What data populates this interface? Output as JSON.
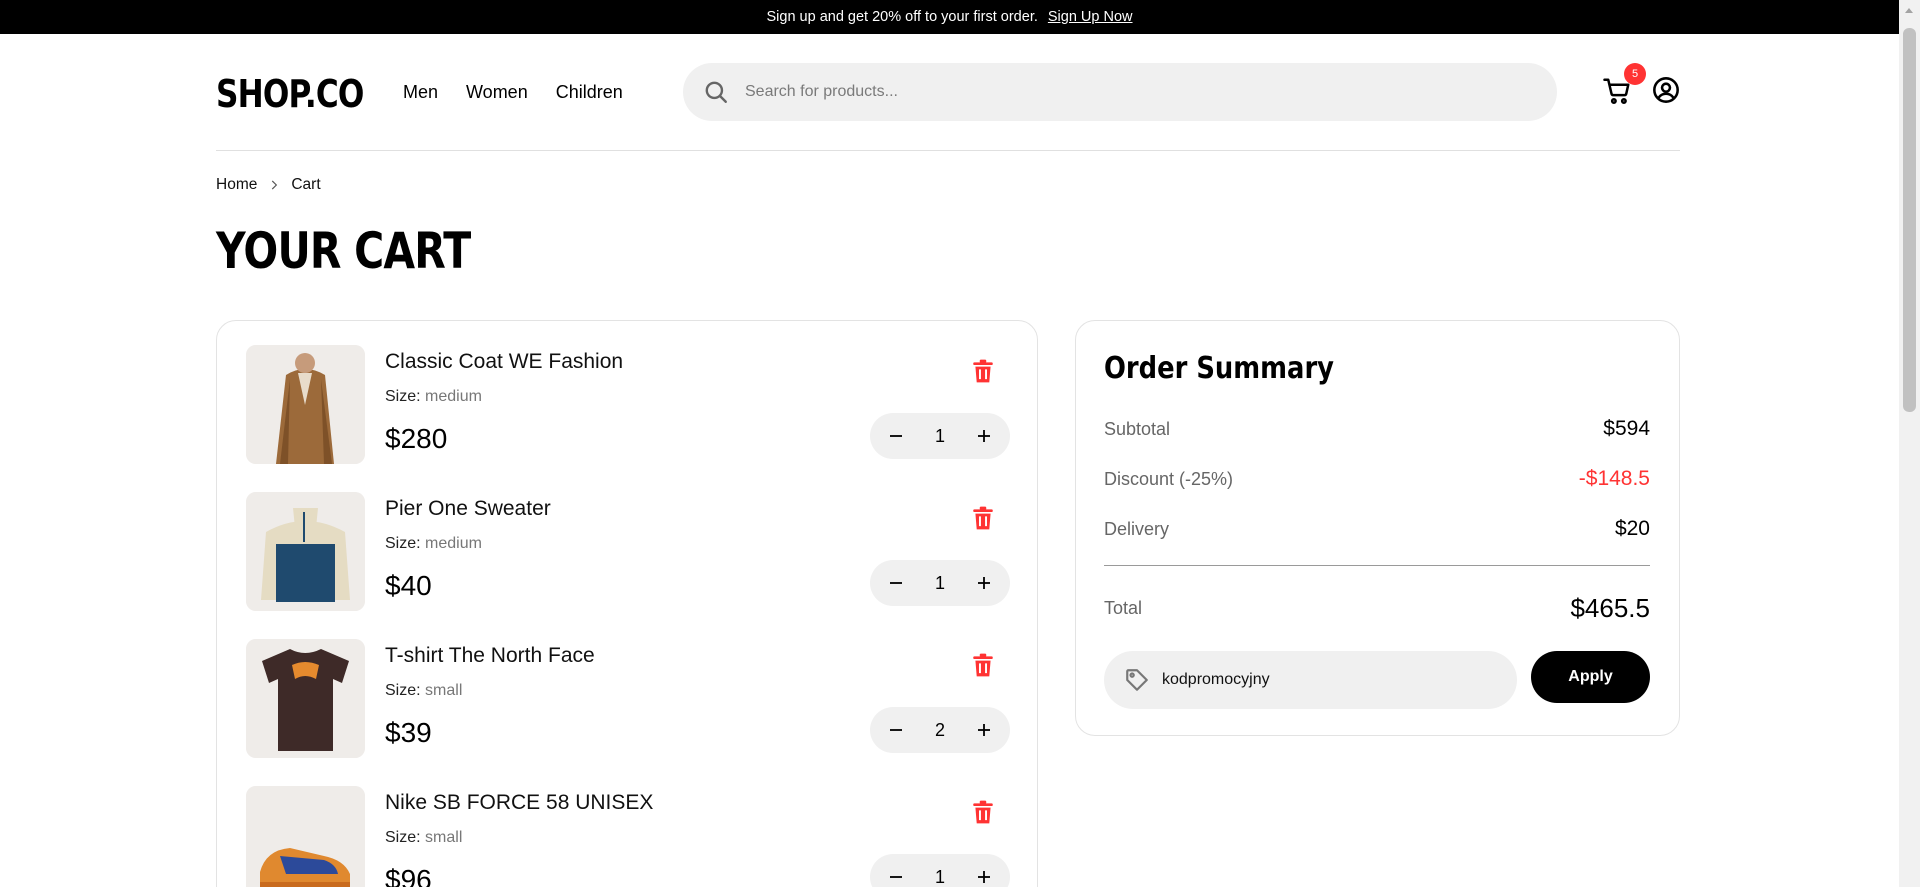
{
  "promo_bar": {
    "text": "Sign up and get 20% off to your first order.",
    "link": "Sign Up Now"
  },
  "header": {
    "logo": "SHOP.CO",
    "nav": [
      "Men",
      "Women",
      "Children"
    ],
    "search_placeholder": "Search for products...",
    "cart_count": "5"
  },
  "breadcrumb": {
    "home": "Home",
    "current": "Cart"
  },
  "page_title": "YOUR CART",
  "cart": {
    "size_label": "Size:",
    "items": [
      {
        "name": "Classic Coat WE Fashion",
        "size": "medium",
        "price": "$280",
        "qty": "1"
      },
      {
        "name": "Pier One Sweater",
        "size": "medium",
        "price": "$40",
        "qty": "1"
      },
      {
        "name": "T-shirt The North Face",
        "size": "small",
        "price": "$39",
        "qty": "2"
      },
      {
        "name": "Nike SB FORCE 58 UNISEX",
        "size": "small",
        "price": "$96",
        "qty": "1"
      }
    ]
  },
  "summary": {
    "title": "Order Summary",
    "subtotal_label": "Subtotal",
    "subtotal": "$594",
    "discount_label": "Discount (-25%)",
    "discount": "-$148.5",
    "delivery_label": "Delivery",
    "delivery": "$20",
    "total_label": "Total",
    "total": "$465.5",
    "promo_value": "kodpromocyjny",
    "apply_label": "Apply"
  },
  "colors": {
    "accent_red": "#ff3333",
    "dark": "#000000",
    "input_bg": "#f0f0f0"
  }
}
